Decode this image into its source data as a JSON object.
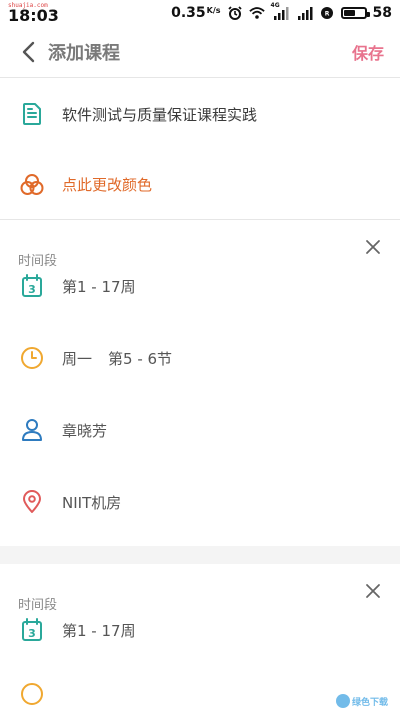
{
  "status_bar": {
    "site_text": "shuajia.com",
    "time": "18:03",
    "speed": "0.35",
    "speed_unit": "K/s",
    "network_label": "4G",
    "battery": "58",
    "battery_level": 0.58
  },
  "header": {
    "title": "添加课程",
    "save_label": "保存"
  },
  "course": {
    "name": "软件测试与质量保证课程实践",
    "color_label": "点此更改颜色"
  },
  "sections": [
    {
      "label": "时间段",
      "weeks": "第1 - 17周",
      "day": "周一",
      "period": "第5 - 6节",
      "calendar_day": "3",
      "teacher": "章晓芳",
      "location": "NIIT机房"
    },
    {
      "label": "时间段",
      "weeks": "第1 - 17周",
      "calendar_day": "3"
    }
  ],
  "colors": {
    "accent": "#e8738d",
    "teal": "#2aa89a",
    "orange": "#e06a2a",
    "yellow": "#f0a830",
    "blue": "#2e7bbf",
    "red": "#e05a5a"
  },
  "watermark": "绿色下载"
}
